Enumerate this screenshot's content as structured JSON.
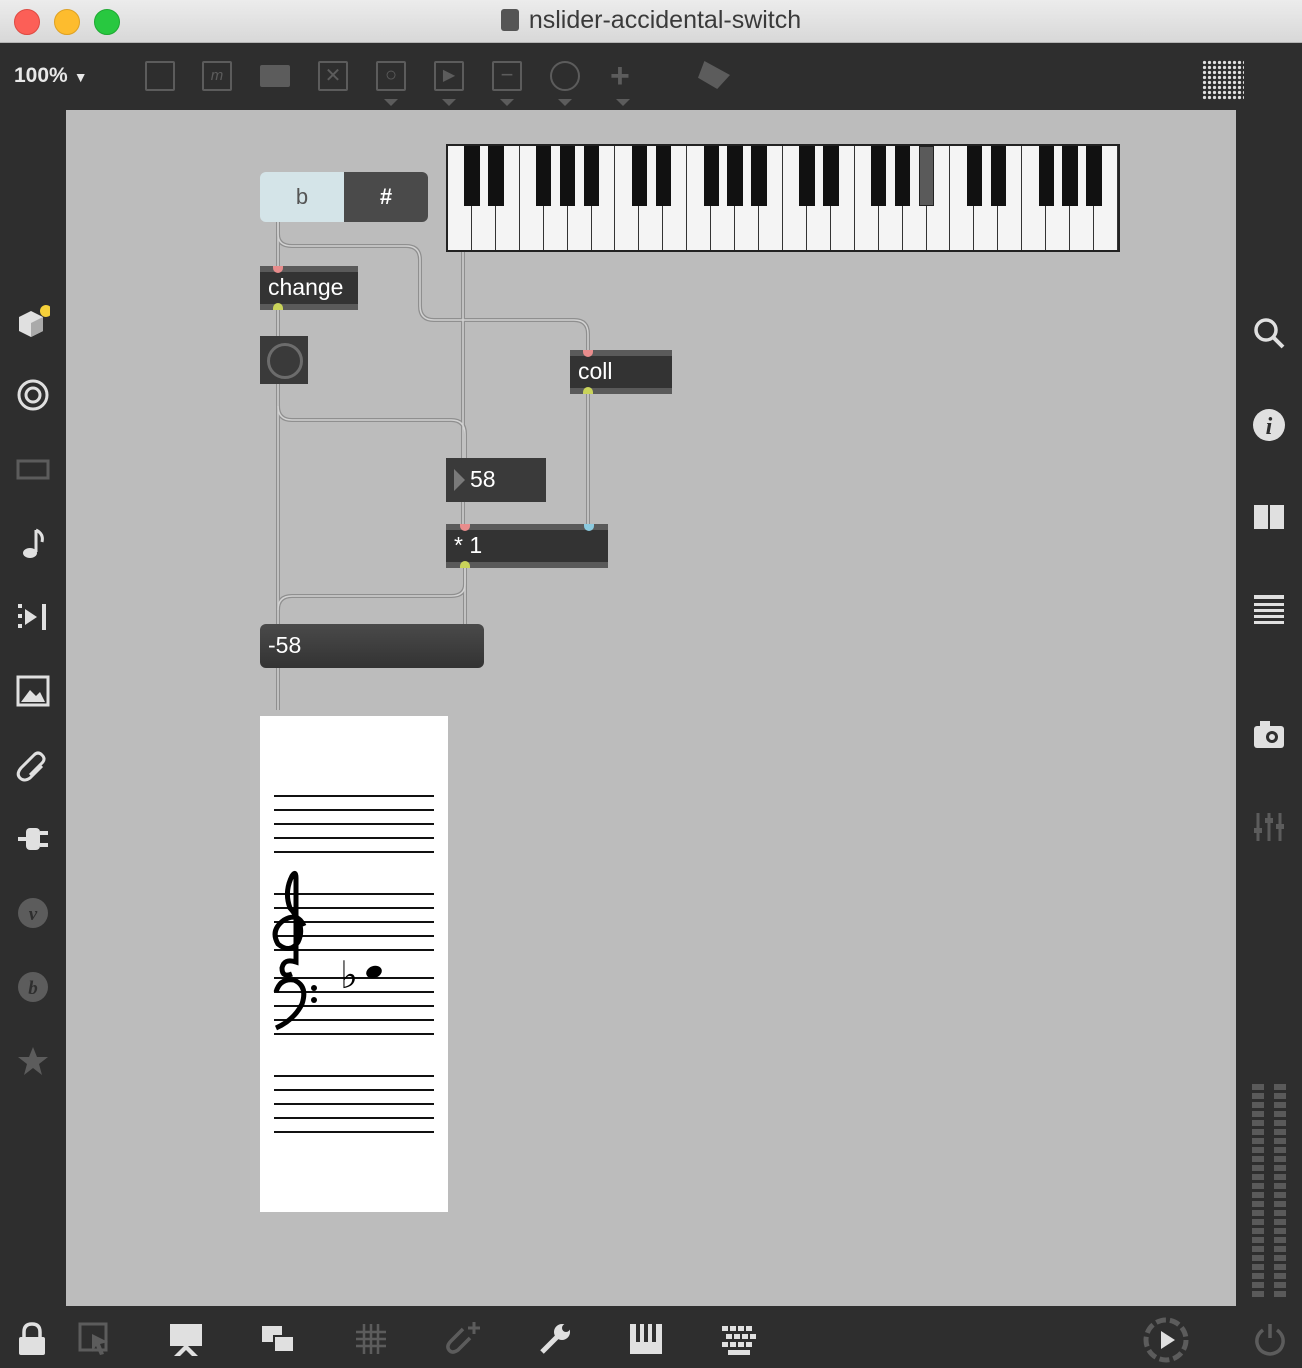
{
  "window": {
    "title": "nslider-accidental-switch"
  },
  "toolbar": {
    "zoom": "100%"
  },
  "patch": {
    "tab_flat": "b",
    "tab_sharp": "#",
    "change_label": "change",
    "coll_label": "coll",
    "number_value": "58",
    "multiply_label": "* 1",
    "result_value": "-58",
    "keyboard_active_key": "A#"
  },
  "notation": {
    "accidental": "♭"
  },
  "icons": {
    "left_sidebar": [
      "package-icon",
      "circle-target-icon",
      "presentation-icon",
      "note-icon",
      "playlist-icon",
      "image-icon",
      "paperclip-icon",
      "plug-icon",
      "vizzie-icon",
      "beap-icon",
      "star-icon"
    ],
    "right_sidebar": [
      "search-icon",
      "info-icon",
      "book-icon",
      "list-icon",
      "snapshot-icon",
      "mixer-icon"
    ],
    "bottom_bar": [
      "lock-icon",
      "select-icon",
      "presentation-screen-icon",
      "windows-icon",
      "grid-icon",
      "paperclip-add-icon",
      "wrench-icon",
      "piano-icon",
      "keyboard-icon",
      "play-icon",
      "power-icon"
    ]
  },
  "colors": {
    "canvas": "#bcbcbc",
    "object": "#333333",
    "selected_tab": "#d4e4e8"
  }
}
